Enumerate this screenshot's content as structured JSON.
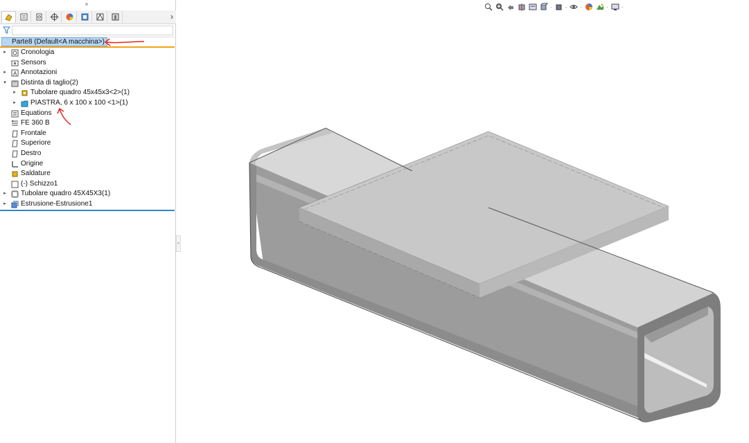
{
  "feature_manager": {
    "tabs": [
      {
        "icon": "feature-manager-tab-icon"
      },
      {
        "icon": "property-manager-tab-icon"
      },
      {
        "icon": "configuration-manager-tab-icon"
      },
      {
        "icon": "dimxpert-manager-tab-icon"
      },
      {
        "icon": "display-manager-tab-icon"
      },
      {
        "icon": "cam-feature-manager-tab-icon"
      },
      {
        "icon": "cam-operation-tab-icon"
      },
      {
        "icon": "cam-tool-tab-icon"
      }
    ],
    "more_symbol": "›",
    "root": {
      "label": "Parte8  (Default<A macchina>)",
      "icon": "part-icon"
    },
    "tree": [
      {
        "label": "Cronologia",
        "icon": "history-folder-icon",
        "level": 0,
        "expand": true
      },
      {
        "label": "Sensors",
        "icon": "sensors-icon",
        "level": 0,
        "expand": false
      },
      {
        "label": "Annotazioni",
        "icon": "annotations-icon",
        "level": 0,
        "expand": true
      },
      {
        "label": "Distinta di taglio(2)",
        "icon": "cut-list-icon",
        "level": 0,
        "expand": true,
        "open": true
      },
      {
        "label": "Tubolare quadro 45x45x3<2>(1)",
        "icon": "weldment-member-icon",
        "level": 1,
        "expand": true
      },
      {
        "label": "PIASTRA, 6 x 100 x 100 <1>(1)",
        "icon": "cut-list-folder-icon",
        "level": 1,
        "expand": true
      },
      {
        "label": "Equations",
        "icon": "equations-icon",
        "level": 0,
        "expand": false
      },
      {
        "label": "FE 360 B",
        "icon": "material-icon",
        "level": 0,
        "expand": false
      },
      {
        "label": "Frontale",
        "icon": "plane-icon",
        "level": 0,
        "expand": false
      },
      {
        "label": "Superiore",
        "icon": "plane-icon",
        "level": 0,
        "expand": false
      },
      {
        "label": "Destro",
        "icon": "plane-icon",
        "level": 0,
        "expand": false
      },
      {
        "label": "Origine",
        "icon": "origin-icon",
        "level": 0,
        "expand": false
      },
      {
        "label": "Saldature",
        "icon": "weldment-icon",
        "level": 0,
        "expand": false
      },
      {
        "label": "(-) Schizzo1",
        "icon": "sketch-icon",
        "level": 0,
        "expand": false
      },
      {
        "label": "Tubolare quadro 45X45X3(1)",
        "icon": "structural-member-icon",
        "level": 0,
        "expand": true
      },
      {
        "label": "Estrusione-Estrusione1",
        "icon": "extrude-icon",
        "level": 0,
        "expand": true
      }
    ]
  },
  "view_toolbar": {
    "buttons": [
      "zoom-to-fit-icon",
      "zoom-to-area-icon",
      "previous-view-icon",
      "section-view-icon",
      "dynamic-annotation-icon",
      "view-orientation-icon",
      "display-style-icon",
      "hide-show-items-icon",
      "edit-appearance-icon",
      "apply-scene-icon",
      "view-settings-icon"
    ],
    "dropdown_symbol": "-"
  },
  "graphics": {
    "model": "tube-with-plate",
    "colors": {
      "tube_top": "#d4d4d4",
      "tube_side": "#9b9b9b",
      "plate_top": "#c6c6c6",
      "plate_edge": "#a8a8a8",
      "inner": "#bdbdbd"
    }
  },
  "annotations": {
    "color": "#e0261f"
  }
}
